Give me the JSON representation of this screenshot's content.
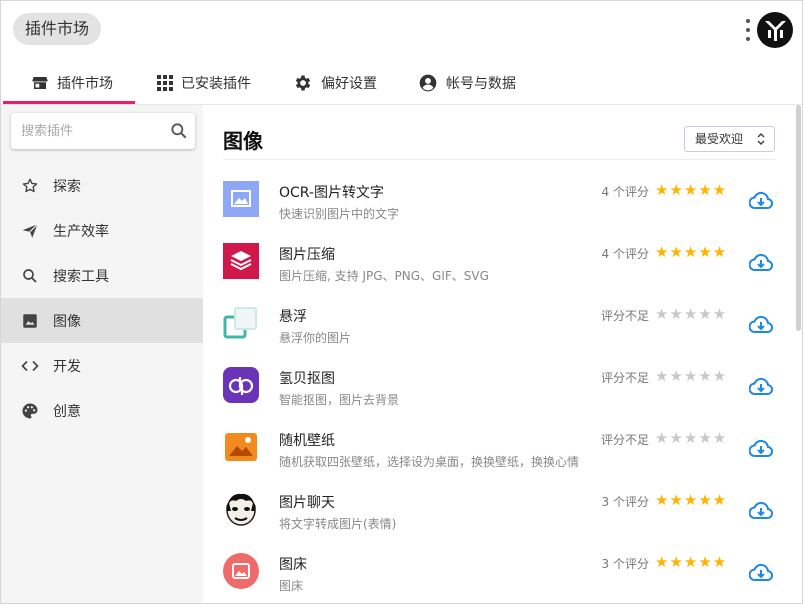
{
  "window": {
    "title": "插件市场"
  },
  "tabs": [
    {
      "label": "插件市场",
      "icon": "store-icon",
      "active": true
    },
    {
      "label": "已安装插件",
      "icon": "grid-icon",
      "active": false
    },
    {
      "label": "偏好设置",
      "icon": "gear-icon",
      "active": false
    },
    {
      "label": "帐号与数据",
      "icon": "account-icon",
      "active": false
    }
  ],
  "sidebar": {
    "search_placeholder": "搜索插件",
    "items": [
      {
        "label": "探索",
        "icon": "star-icon"
      },
      {
        "label": "生产效率",
        "icon": "send-icon"
      },
      {
        "label": "搜索工具",
        "icon": "search-icon"
      },
      {
        "label": "图像",
        "icon": "image-icon",
        "active": true
      },
      {
        "label": "开发",
        "icon": "code-icon"
      },
      {
        "label": "创意",
        "icon": "palette-icon"
      }
    ]
  },
  "main": {
    "title": "图像",
    "sort": {
      "selected": "最受欢迎"
    },
    "plugins": [
      {
        "name": "OCR-图片转文字",
        "desc": "快速识别图片中的文字",
        "rating_text": "4 个评分",
        "stars": 5,
        "icon": "ocr-image-icon",
        "color": "#8ea8f5"
      },
      {
        "name": "图片压缩",
        "desc": "图片压缩, 支持 JPG、PNG、GIF、SVG",
        "rating_text": "4 个评分",
        "stars": 5,
        "icon": "layers-icon",
        "color": "#d0184b"
      },
      {
        "name": "悬浮",
        "desc": "悬浮你的图片",
        "rating_text": "评分不足",
        "stars": 0,
        "icon": "float-icon",
        "color": "#3fb8a6"
      },
      {
        "name": "氢贝抠图",
        "desc": "智能抠图，图片去背景",
        "rating_text": "评分不足",
        "stars": 0,
        "icon": "qb-icon",
        "color": "#6a33b8"
      },
      {
        "name": "随机壁纸",
        "desc": "随机获取四张壁纸，选择设为桌面，换换壁纸，换换心情",
        "rating_text": "评分不足",
        "stars": 0,
        "icon": "wallpaper-icon",
        "color": "#f28b1f"
      },
      {
        "name": "图片聊天",
        "desc": "将文字转成图片(表情)",
        "rating_text": "3 个评分",
        "stars": 5,
        "icon": "meme-face-icon",
        "color": "#222222"
      },
      {
        "name": "图床",
        "desc": "图床",
        "rating_text": "3 个评分",
        "stars": 5,
        "icon": "image-host-icon",
        "color": "#f06a6a"
      }
    ]
  },
  "colors": {
    "accent": "#e91e63",
    "download": "#1e88e5",
    "star": "#ffb400"
  }
}
